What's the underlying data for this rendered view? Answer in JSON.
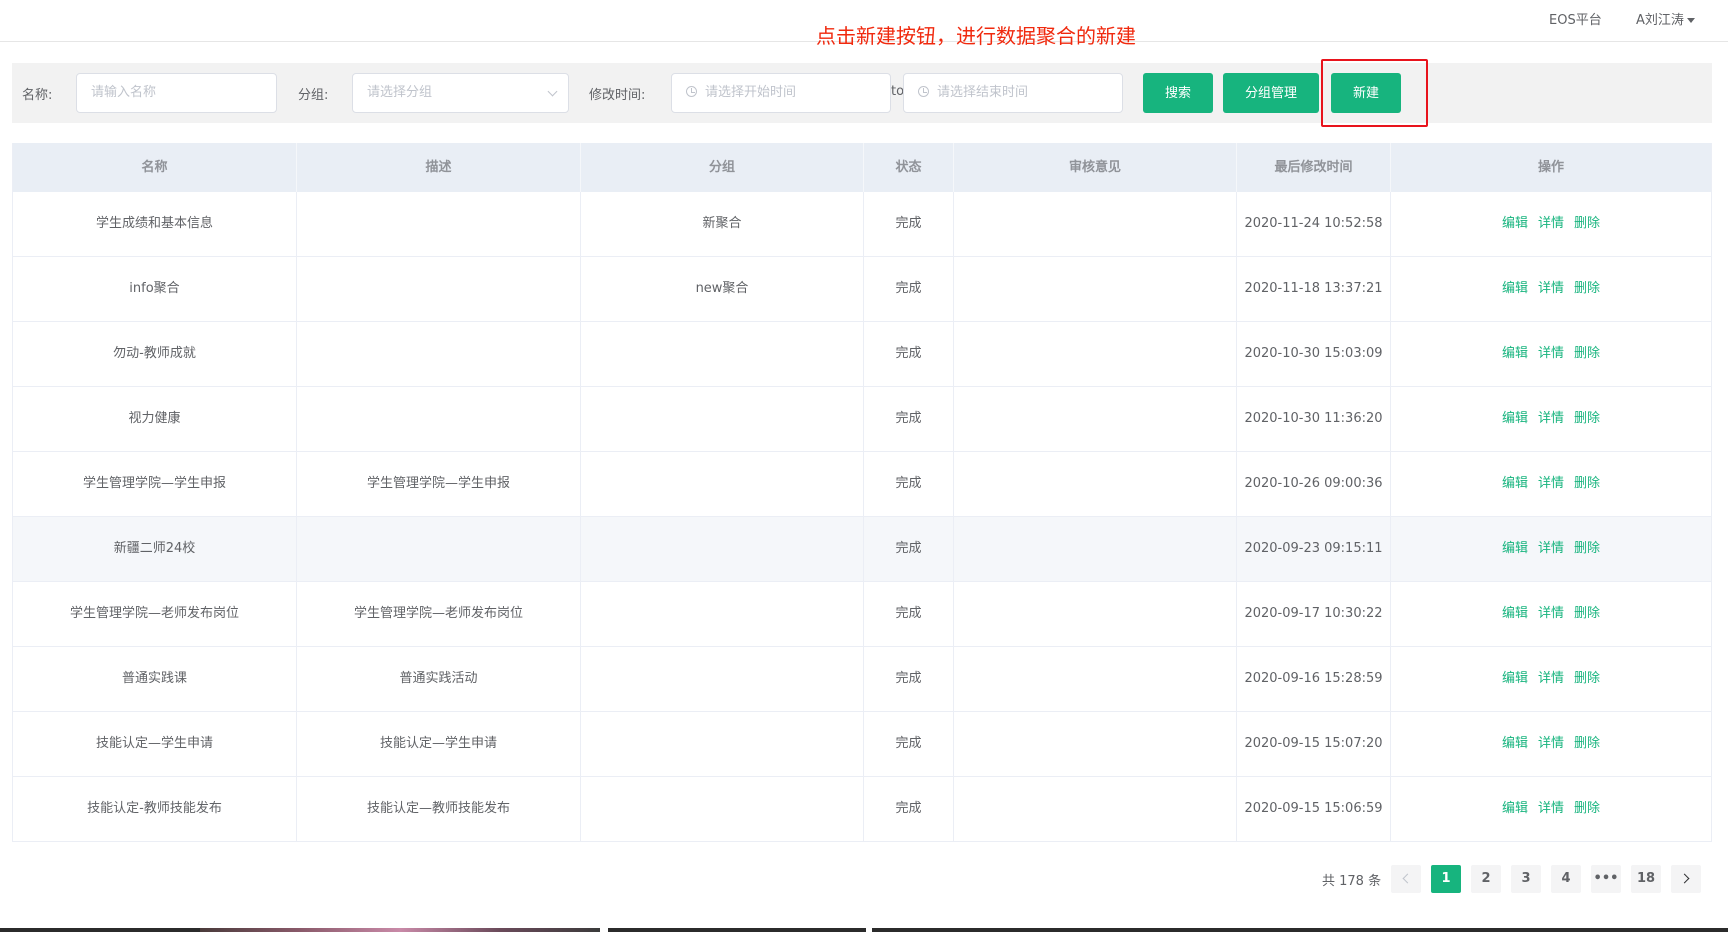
{
  "header": {
    "platform_link": "EOS平台",
    "user_name": "A刘江涛"
  },
  "annotation": {
    "text": "点击新建按钮，进行数据聚合的新建",
    "color": "#f0290e"
  },
  "filters": {
    "name_label": "名称:",
    "name_placeholder": "请输入名称",
    "group_label": "分组:",
    "group_placeholder": "请选择分组",
    "time_label": "修改时间:",
    "start_placeholder": "请选择开始时间",
    "range_separator": "to",
    "end_placeholder": "请选择结束时间"
  },
  "buttons": {
    "search": "搜索",
    "group_manage": "分组管理",
    "create": "新建"
  },
  "colors": {
    "accent": "#17b47e",
    "highlight_border": "#e8131c"
  },
  "table": {
    "headers": [
      "名称",
      "描述",
      "分组",
      "状态",
      "审核意见",
      "最后修改时间",
      "操作"
    ],
    "actions": {
      "edit": "编辑",
      "detail": "详情",
      "delete": "删除"
    },
    "rows": [
      {
        "name": "学生成绩和基本信息",
        "desc": "",
        "group": "新聚合",
        "status": "完成",
        "review": "",
        "time": "2020-11-24 10:52:58"
      },
      {
        "name": "info聚合",
        "desc": "",
        "group": "new聚合",
        "status": "完成",
        "review": "",
        "time": "2020-11-18 13:37:21"
      },
      {
        "name": "勿动-教师成就",
        "desc": "",
        "group": "",
        "status": "完成",
        "review": "",
        "time": "2020-10-30 15:03:09"
      },
      {
        "name": "视力健康",
        "desc": "",
        "group": "",
        "status": "完成",
        "review": "",
        "time": "2020-10-30 11:36:20"
      },
      {
        "name": "学生管理学院—学生申报",
        "desc": "学生管理学院—学生申报",
        "group": "",
        "status": "完成",
        "review": "",
        "time": "2020-10-26 09:00:36"
      },
      {
        "name": "新疆二师24校",
        "desc": "",
        "group": "",
        "status": "完成",
        "review": "",
        "time": "2020-09-23 09:15:11"
      },
      {
        "name": "学生管理学院—老师发布岗位",
        "desc": "学生管理学院—老师发布岗位",
        "group": "",
        "status": "完成",
        "review": "",
        "time": "2020-09-17 10:30:22"
      },
      {
        "name": "普通实践课",
        "desc": "普通实践活动",
        "group": "",
        "status": "完成",
        "review": "",
        "time": "2020-09-16 15:28:59"
      },
      {
        "name": "技能认定—学生申请",
        "desc": "技能认定—学生申请",
        "group": "",
        "status": "完成",
        "review": "",
        "time": "2020-09-15 15:07:20"
      },
      {
        "name": "技能认定-教师技能发布",
        "desc": "技能认定—教师技能发布",
        "group": "",
        "status": "完成",
        "review": "",
        "time": "2020-09-15 15:06:59"
      }
    ]
  },
  "pagination": {
    "total_text": "共 178 条",
    "pages": [
      "1",
      "2",
      "3",
      "4",
      "•••",
      "18"
    ],
    "current": "1"
  }
}
